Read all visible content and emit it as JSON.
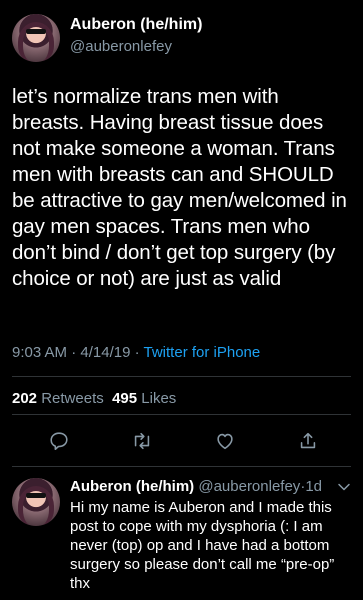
{
  "tweet": {
    "author_name": "Auberon (he/him)",
    "author_handle": "@auberonlefey",
    "text": "let’s normalize trans men with breasts. Having breast tissue does not make someone a woman. Trans men with breasts can and SHOULD be attractive to gay men/welcomed in gay men spaces. Trans men who don’t bind / don’t get top surgery (by choice or not) are just as valid",
    "time": "9:03 AM",
    "date": "4/14/19",
    "separator": "·",
    "source": "Twitter for iPhone",
    "retweets_count": "202",
    "retweets_label": "Retweets",
    "likes_count": "495",
    "likes_label": "Likes"
  },
  "actions": {
    "icons": [
      "reply-icon",
      "retweet-icon",
      "like-icon",
      "share-icon"
    ]
  },
  "reply": {
    "author_name": "Auberon (he/him)",
    "author_handle": "@auberonlefey",
    "separator": "·",
    "age": "1d",
    "text": "Hi my name is Auberon and I made this post to cope with my dysphoria (: I am never (top) op and I have had a bottom surgery so please don’t call me “pre-op” thx"
  },
  "colors": {
    "background": "#000000",
    "secondary_text": "#8899a6",
    "link": "#1da1f2",
    "divider": "#2f3336"
  }
}
